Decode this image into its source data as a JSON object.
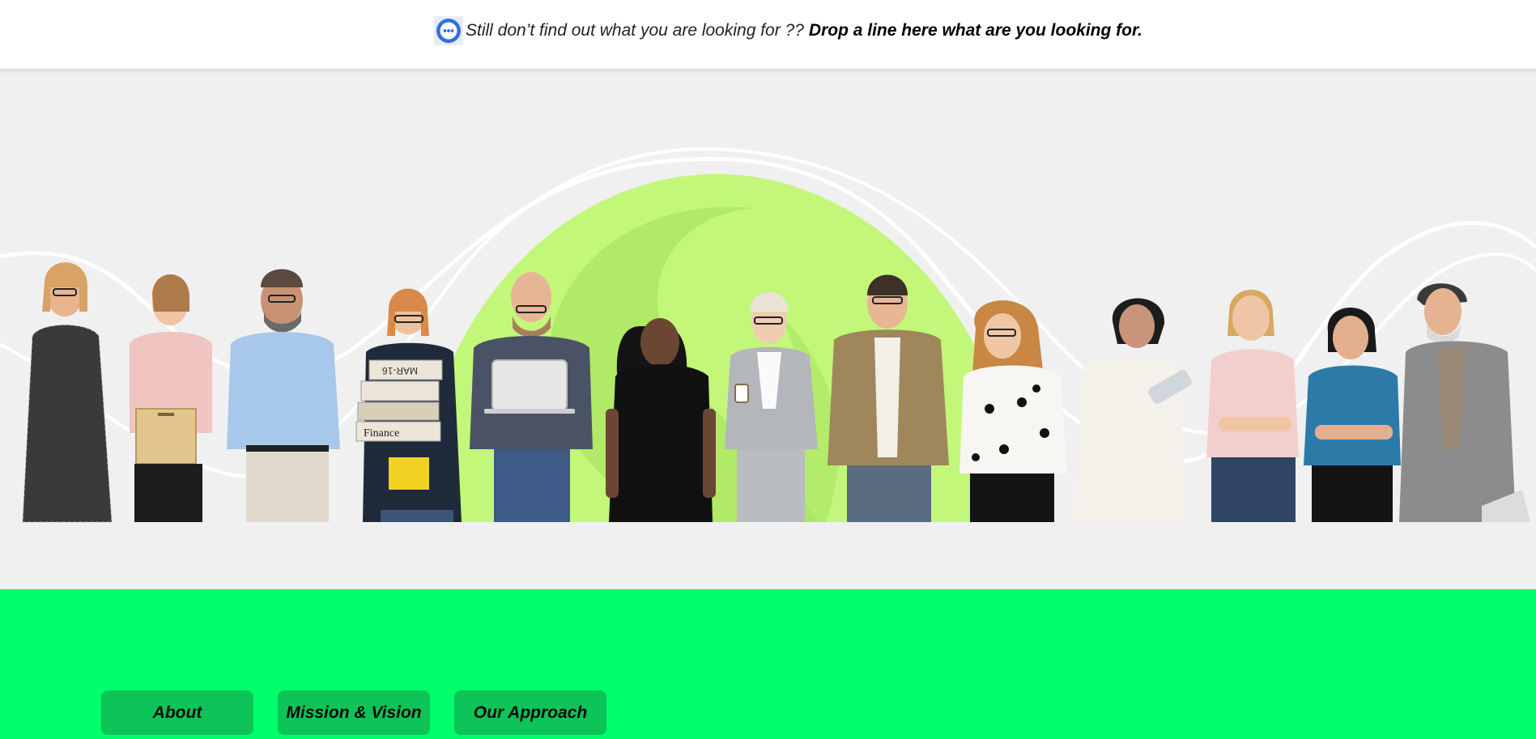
{
  "notice": {
    "icon": "chat-bubble-icon",
    "question": "Still don’t find out what you are looking for ??",
    "cta": "Drop a line here what are you looking for."
  },
  "hero": {
    "illustration": "group-of-diverse-people-banner",
    "colors": {
      "blob": "#c3f77a",
      "blob_shade": "#a9e560",
      "background": "#f0f0f0",
      "waves": "#ffffff"
    },
    "props": {
      "binder_labels": [
        "MAR-16",
        "Finance"
      ]
    }
  },
  "nav": {
    "about": "About",
    "mission": "Mission & Vision",
    "approach": "Our Approach"
  },
  "colors": {
    "accent_band": "#00ff6a",
    "button": "#0cc458"
  }
}
